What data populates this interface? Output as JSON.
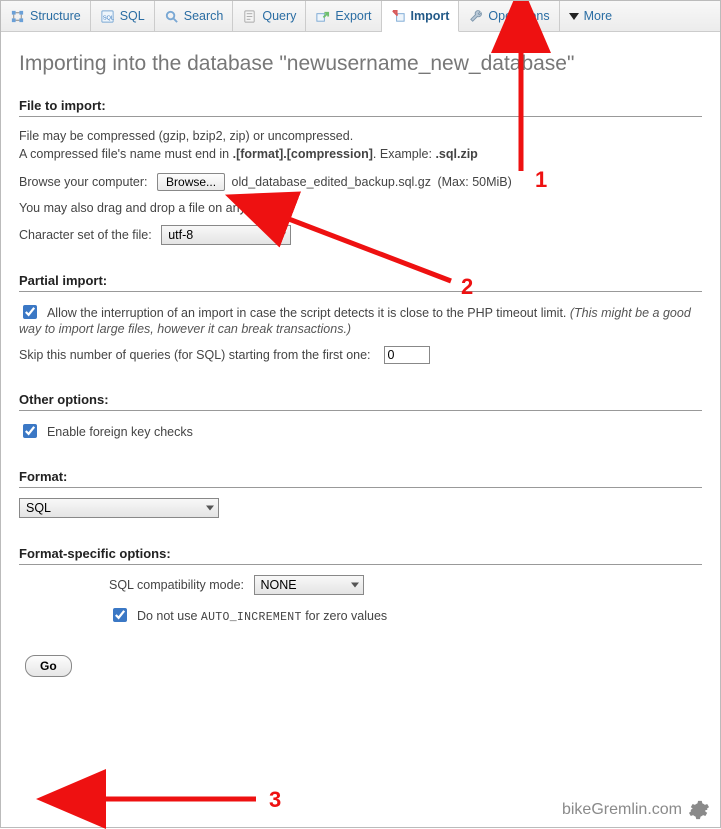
{
  "tabs": {
    "structure": "Structure",
    "sql": "SQL",
    "search": "Search",
    "query": "Query",
    "export": "Export",
    "import": "Import",
    "operations": "Operations",
    "more": "More"
  },
  "title": "Importing into the database \"newusername_new_database\"",
  "sections": {
    "file_to_import": "File to import:",
    "partial_import": "Partial import:",
    "other_options": "Other options:",
    "format": "Format:",
    "format_specific": "Format-specific options:"
  },
  "file": {
    "compressed_note_1": "File may be compressed (gzip, bzip2, zip) or uncompressed.",
    "compressed_note_2a": "A compressed file's name must end in ",
    "compressed_note_2b": ".[format].[compression]",
    "compressed_note_2c": ". Example: ",
    "compressed_note_2d": ".sql.zip",
    "browse_label": "Browse your computer:",
    "browse_button": "Browse...",
    "selected_file": "old_database_edited_backup.sql.gz",
    "max_note": "(Max: 50MiB)",
    "dragdrop": "You may also drag and drop a file on any page.",
    "charset_label": "Character set of the file:",
    "charset_value": "utf-8"
  },
  "partial": {
    "allow_label_a": "Allow the interruption of an import in case the script detects it is close to the PHP timeout limit. ",
    "allow_label_b": "(This might be a good way to import large files, however it can break transactions.)",
    "skip_label": "Skip this number of queries (for SQL) starting from the first one:",
    "skip_value": "0"
  },
  "other": {
    "fk_label": "Enable foreign key checks"
  },
  "format": {
    "value": "SQL"
  },
  "formatspec": {
    "compat_label": "SQL compatibility mode:",
    "compat_value": "NONE",
    "autoinc_a": "Do not use ",
    "autoinc_code": "AUTO_INCREMENT",
    "autoinc_b": " for zero values"
  },
  "go_label": "Go",
  "annotations": {
    "n1": "1",
    "n2": "2",
    "n3": "3"
  },
  "watermark": "bikeGremlin.com"
}
